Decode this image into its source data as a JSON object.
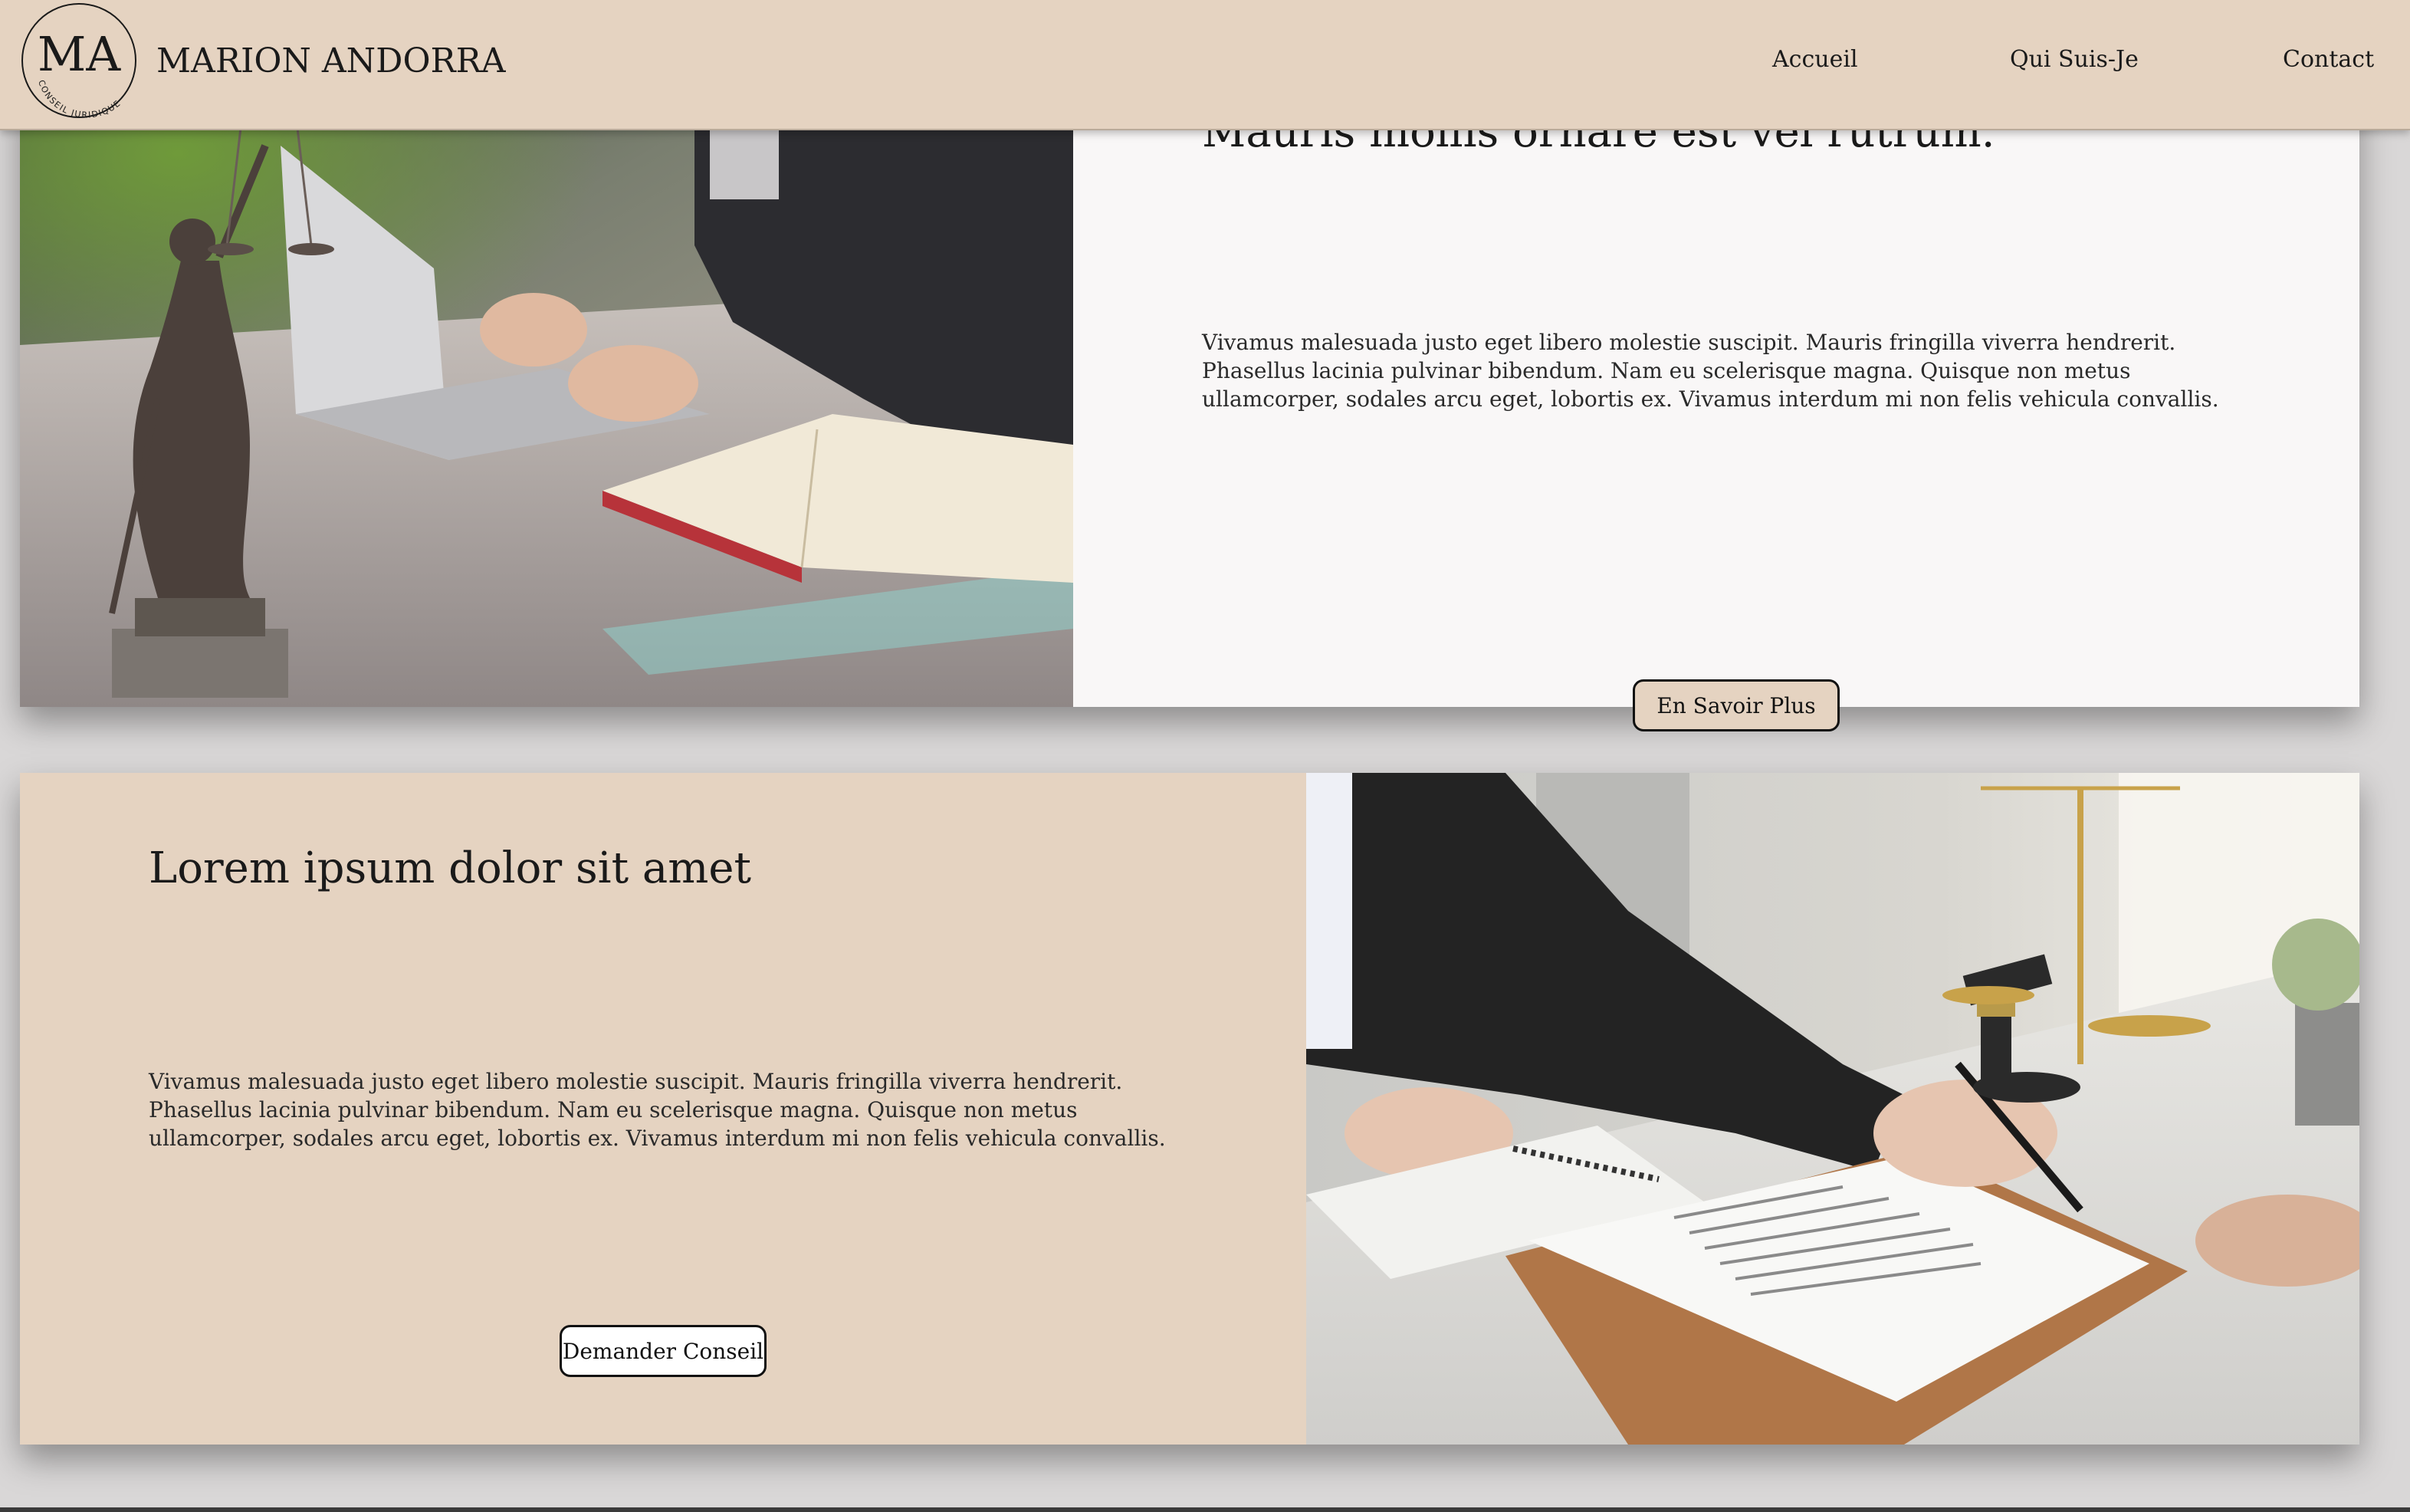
{
  "header": {
    "logo_monogram": "MA",
    "logo_ring_text": "CONSEIL JURIDIQUE",
    "brand_name": "MARION ANDORRA",
    "nav": {
      "accueil": "Accueil",
      "qui_suis_je": "Qui Suis-Je",
      "contact": "Contact"
    }
  },
  "section1": {
    "heading": "Mauris mollis ornare est vel rutrum.",
    "body": "Vivamus malesuada justo eget libero molestie suscipit. Mauris fringilla viverra hendrerit. Phasellus lacinia pulvinar bibendum. Nam eu scelerisque magna. Quisque non metus ullamcorper, sodales arcu eget, lobortis ex. Vivamus interdum mi non felis vehicula convallis.",
    "button_label": "En Savoir Plus"
  },
  "section2": {
    "heading": "Lorem ipsum dolor sit amet",
    "body": "Vivamus malesuada justo eget libero molestie suscipit. Mauris fringilla viverra hendrerit. Phasellus lacinia pulvinar bibendum. Nam eu scelerisque magna. Quisque non metus ullamcorper, sodales arcu eget, lobortis ex. Vivamus interdum mi non felis vehicula convallis.",
    "button_label": "Demander Conseil"
  },
  "colors": {
    "beige": "#e5d3c1",
    "offwhite": "#f9f7f7",
    "text": "#1a1a1a"
  }
}
